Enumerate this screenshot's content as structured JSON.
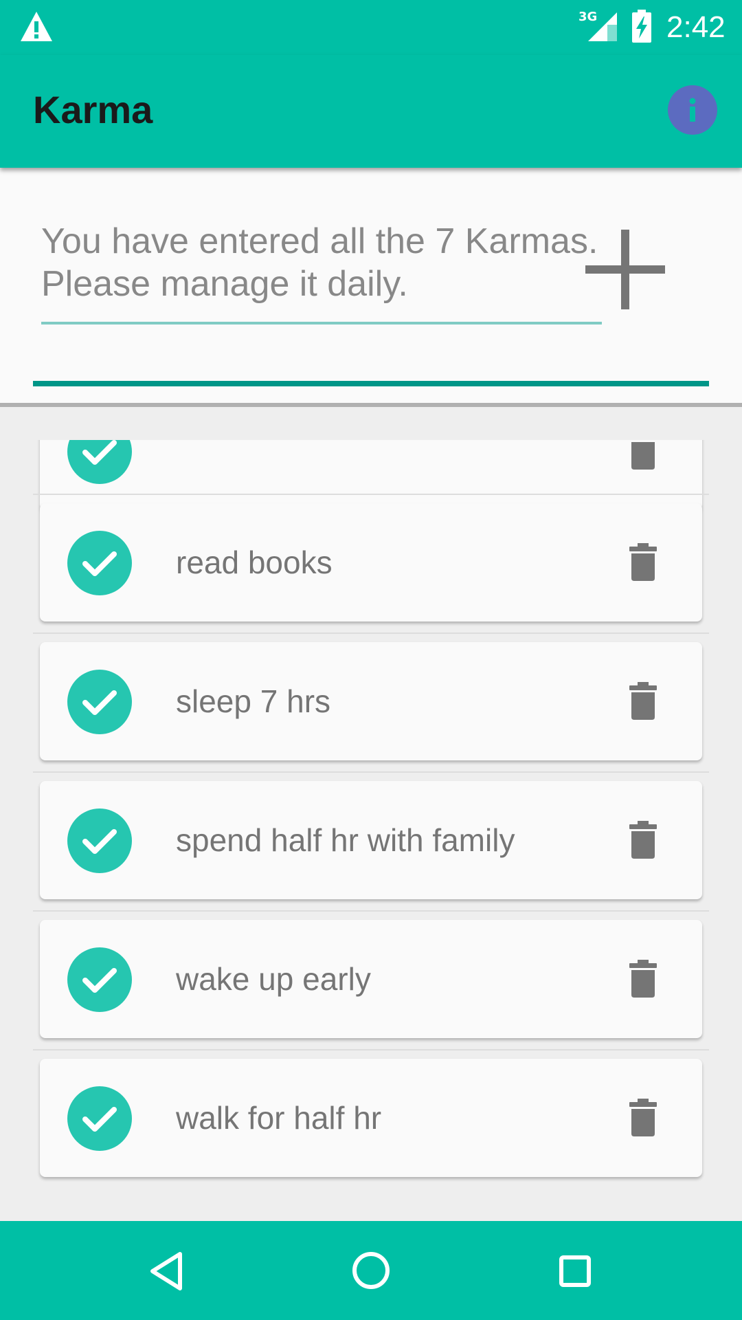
{
  "status_bar": {
    "network": "3G",
    "time": "2:42",
    "icons": [
      "warning-icon",
      "signal-icon",
      "battery-charging-icon"
    ]
  },
  "app_bar": {
    "title": "Karma",
    "info_icon": "info-icon"
  },
  "input": {
    "value": "You have entered all the 7 Karmas. Please manage it daily.",
    "add_icon": "plus-icon"
  },
  "karmas": [
    {
      "label": "",
      "done": true
    },
    {
      "label": "read books",
      "done": true
    },
    {
      "label": "sleep 7 hrs",
      "done": true
    },
    {
      "label": "spend half hr with family",
      "done": true
    },
    {
      "label": "wake up early",
      "done": true
    },
    {
      "label": "walk for half hr",
      "done": true
    }
  ],
  "nav": {
    "icons": [
      "back-icon",
      "home-icon",
      "recents-icon"
    ]
  },
  "colors": {
    "primary": "#00bfa5",
    "accent": "#5c6bc0",
    "check": "#26c6b0",
    "progress": "#009688"
  }
}
